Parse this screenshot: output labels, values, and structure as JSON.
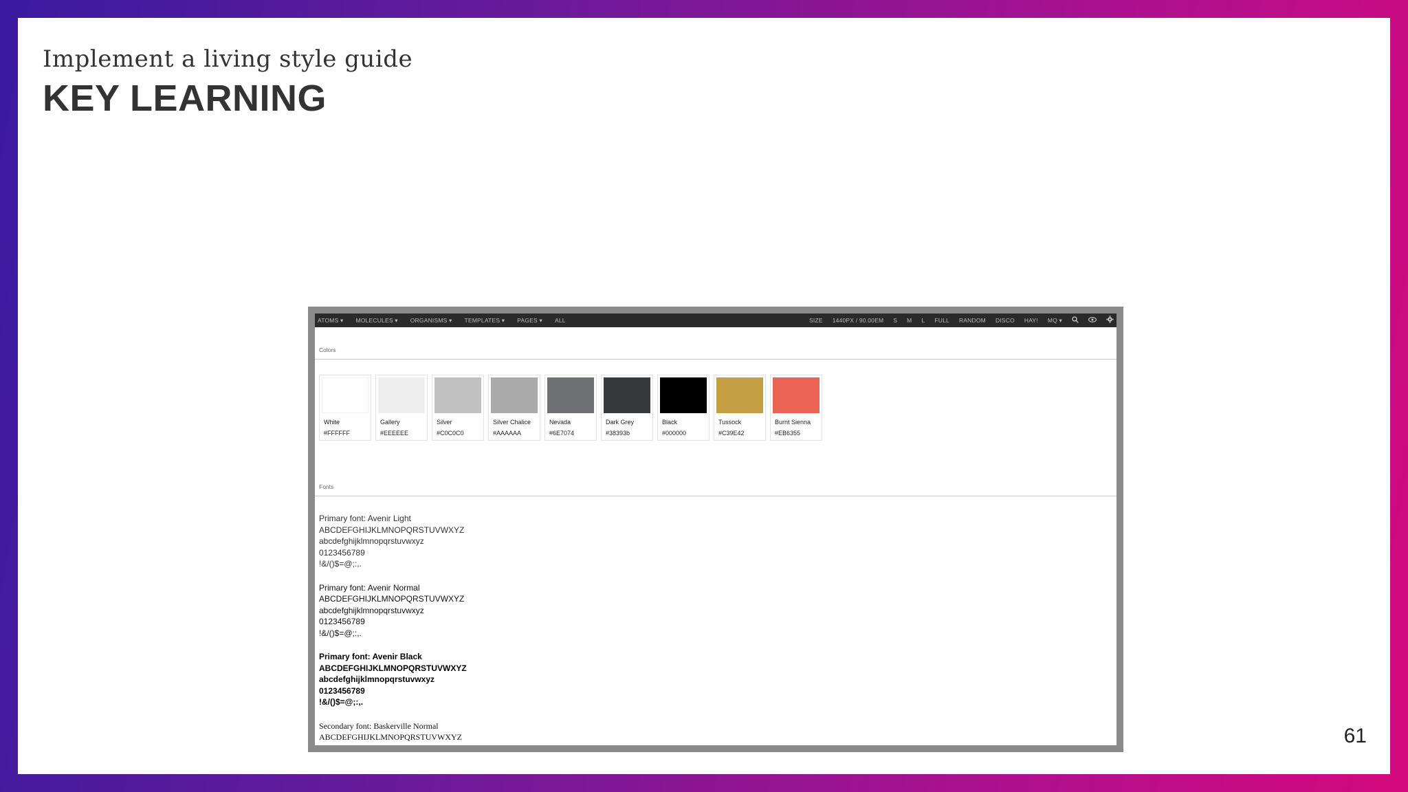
{
  "slide": {
    "subtitle": "Implement a living style guide",
    "title": "KEY LEARNING",
    "page_number": "61"
  },
  "toolbar": {
    "left_items": [
      "ATOMS ▾",
      "MOLECULES ▾",
      "ORGANISMS ▾",
      "TEMPLATES ▾",
      "PAGES ▾",
      "ALL"
    ],
    "right_items": [
      "SIZE",
      "1440PX / 90.00EM",
      "S",
      "M",
      "L",
      "FULL",
      "RANDOM",
      "DISCO",
      "HAY!",
      "MQ ▾"
    ],
    "icons": [
      "search-icon",
      "eye-icon",
      "gear-icon"
    ]
  },
  "colors_section": {
    "label": "Colors",
    "swatches": [
      {
        "name": "White",
        "hex": "#FFFFFF",
        "color": "#FFFFFF"
      },
      {
        "name": "Gallery",
        "hex": "#EEEEEE",
        "color": "#EEEEEE"
      },
      {
        "name": "Silver",
        "hex": "#C0C0C0",
        "color": "#C0C0C0"
      },
      {
        "name": "Silver Chalice",
        "hex": "#AAAAAA",
        "color": "#AAAAAA"
      },
      {
        "name": "Nevada",
        "hex": "#6E7074",
        "color": "#6E7074"
      },
      {
        "name": "Dark Grey",
        "hex": "#38393b",
        "color": "#38393B"
      },
      {
        "name": "Black",
        "hex": "#000000",
        "color": "#000000"
      },
      {
        "name": "Tussock",
        "hex": "#C39E42",
        "color": "#C39E42"
      },
      {
        "name": "Burnt Sienna",
        "hex": "#EB6355",
        "color": "#EB6355"
      }
    ]
  },
  "fonts_section": {
    "label": "Fonts",
    "blocks": [
      {
        "heading": "Primary font: Avenir Light",
        "upper": "ABCDEFGHIJKLMNOPQRSTUVWXYZ",
        "lower": "abcdefghijklmnopqrstuvwxyz",
        "digits": "0123456789",
        "symbols": "!&/()$=@;:,."
      },
      {
        "heading": "Primary font: Avenir Normal",
        "upper": "ABCDEFGHIJKLMNOPQRSTUVWXYZ",
        "lower": "abcdefghijklmnopqrstuvwxyz",
        "digits": "0123456789",
        "symbols": "!&/()$=@;:,."
      },
      {
        "heading": "Primary font: Avenir Black",
        "upper": "ABCDEFGHIJKLMNOPQRSTUVWXYZ",
        "lower": "abcdefghijklmnopqrstuvwxyz",
        "digits": "0123456789",
        "symbols": "!&/()$=@;:,."
      },
      {
        "heading": "Secondary font: Baskerville Normal",
        "upper": "ABCDEFGHIJKLMNOPQRSTUVWXYZ"
      }
    ]
  }
}
